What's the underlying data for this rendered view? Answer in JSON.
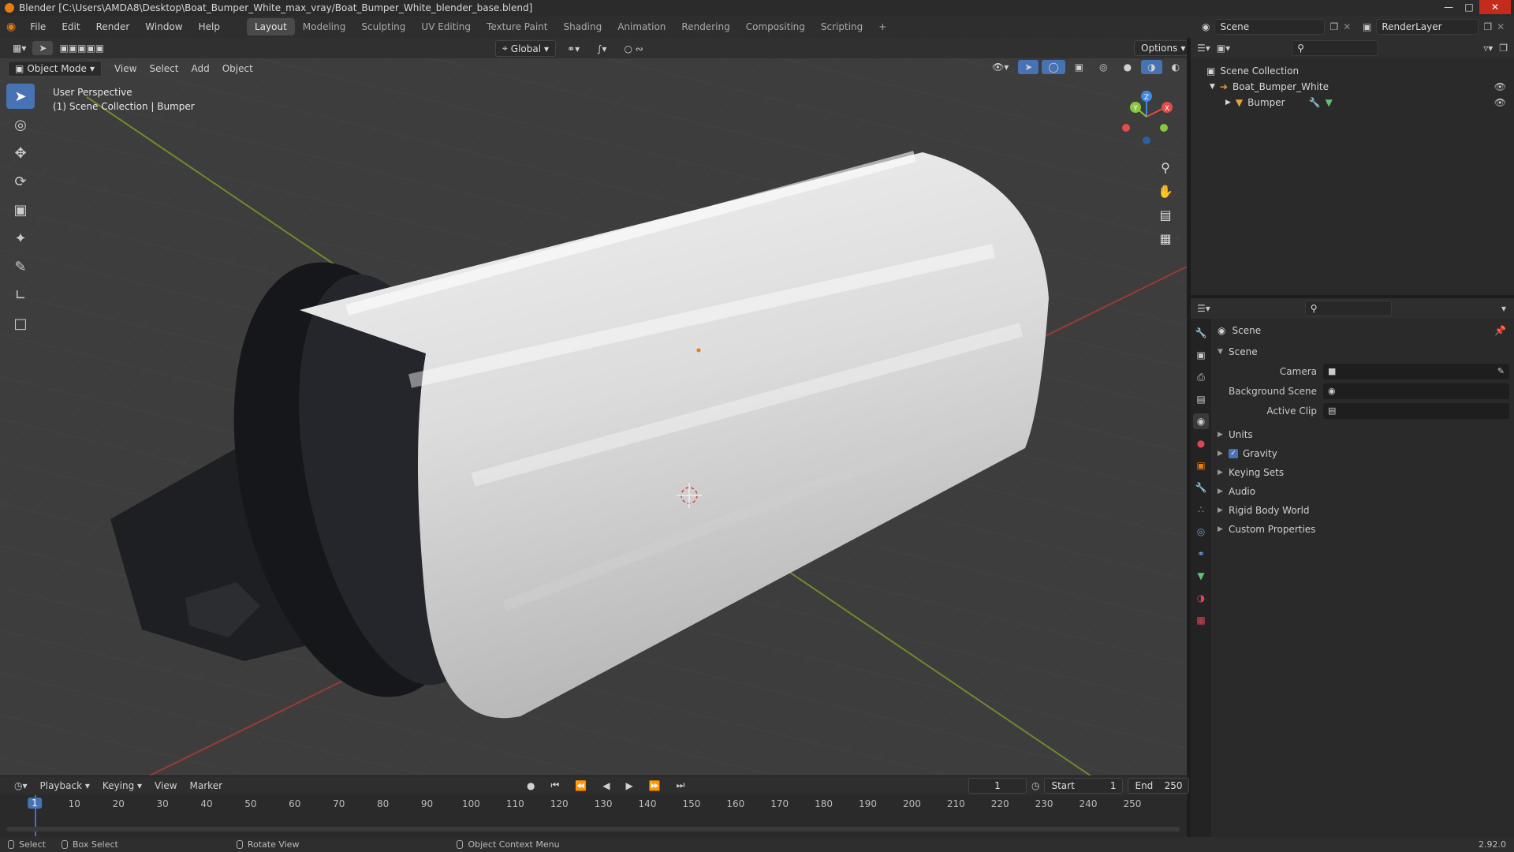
{
  "window": {
    "title": "Blender [C:\\Users\\AMDA8\\Desktop\\Boat_Bumper_White_max_vray/Boat_Bumper_White_blender_base.blend]"
  },
  "menu": {
    "items": [
      "File",
      "Edit",
      "Render",
      "Window",
      "Help"
    ],
    "workspaces": [
      "Layout",
      "Modeling",
      "Sculpting",
      "UV Editing",
      "Texture Paint",
      "Shading",
      "Animation",
      "Rendering",
      "Compositing",
      "Scripting"
    ],
    "active_workspace": "Layout",
    "add_workspace": "+",
    "scene_name": "Scene",
    "render_layer": "RenderLayer"
  },
  "viewport": {
    "mode": "Object Mode",
    "menus": [
      "View",
      "Select",
      "Add",
      "Object"
    ],
    "transform_orientation": "Global",
    "options_label": "Options",
    "perspective_label": "User Perspective",
    "collection_label": "(1) Scene Collection | Bumper",
    "gizmo_axes": {
      "x": "X",
      "y": "Y",
      "z": "Z"
    }
  },
  "outliner": {
    "root": "Scene Collection",
    "collection": "Boat_Bumper_White",
    "object": "Bumper"
  },
  "properties": {
    "context": "Scene",
    "panel_title": "Scene",
    "fields": [
      {
        "label": "Camera",
        "value": ""
      },
      {
        "label": "Background Scene",
        "value": ""
      },
      {
        "label": "Active Clip",
        "value": ""
      }
    ],
    "panels": [
      "Units",
      "Gravity",
      "Keying Sets",
      "Audio",
      "Rigid Body World",
      "Custom Properties"
    ],
    "gravity_checked": true
  },
  "timeline": {
    "menus": [
      "Playback",
      "Keying",
      "View",
      "Marker"
    ],
    "current_frame": "1",
    "start_label": "Start",
    "start_value": "1",
    "end_label": "End",
    "end_value": "250",
    "ticks": [
      "10",
      "20",
      "30",
      "40",
      "50",
      "60",
      "70",
      "80",
      "90",
      "100",
      "110",
      "120",
      "130",
      "140",
      "150",
      "160",
      "170",
      "180",
      "190",
      "200",
      "210",
      "220",
      "230",
      "240",
      "250"
    ],
    "cursor_label": "1"
  },
  "statusbar": {
    "select": "Select",
    "box_select": "Box Select",
    "rotate_view": "Rotate View",
    "context_menu": "Object Context Menu",
    "version": "2.92.0"
  },
  "colors": {
    "accent": "#4772b3",
    "brand": "#e87d0d",
    "axis_x": "#e44b4b",
    "axis_y": "#8cc63f",
    "axis_z": "#3d8ae0"
  }
}
